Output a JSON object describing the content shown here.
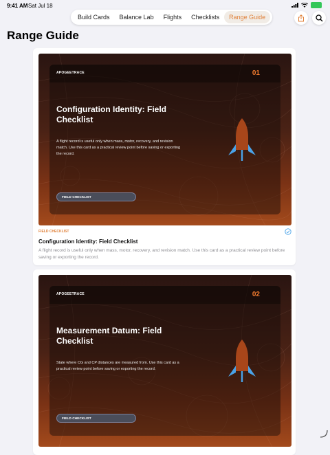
{
  "status": {
    "time": "9:41 AM",
    "date": "Sat Jul 18"
  },
  "nav": {
    "tabs": [
      {
        "label": "Build Cards",
        "active": false
      },
      {
        "label": "Balance Lab",
        "active": false
      },
      {
        "label": "Flights",
        "active": false
      },
      {
        "label": "Checklists",
        "active": false
      },
      {
        "label": "Range Guide",
        "active": true
      }
    ]
  },
  "actions": {
    "share_icon": "share-icon",
    "search_icon": "search-icon"
  },
  "page": {
    "title": "Range Guide"
  },
  "colors": {
    "accent": "#e0823b",
    "number": "#f07a2e",
    "rocket_body": "#a8461a",
    "rocket_fins": "#4aa3e8"
  },
  "cards": [
    {
      "brand": "APOGEETRACE",
      "number": "01",
      "hero_title": "Configuration Identity: Field Checklist",
      "hero_description": "A flight record is useful only when mass, motor, recovery, and revision match. Use this card as a practical review point before saving or exporting the record.",
      "pill": "FIELD CHECKLIST",
      "category": "FIELD CHECKLIST",
      "title": "Configuration Identity: Field Checklist",
      "description": "A flight record is useful only when mass, motor, recovery, and revision match. Use this card as a practical review point before saving or exporting the record."
    },
    {
      "brand": "APOGEETRACE",
      "number": "02",
      "hero_title": "Measurement Datum: Field Checklist",
      "hero_description": "State where CG and CP distances are measured from. Use this card as a practical review point before saving or exporting the record.",
      "pill": "FIELD CHECKLIST"
    }
  ]
}
